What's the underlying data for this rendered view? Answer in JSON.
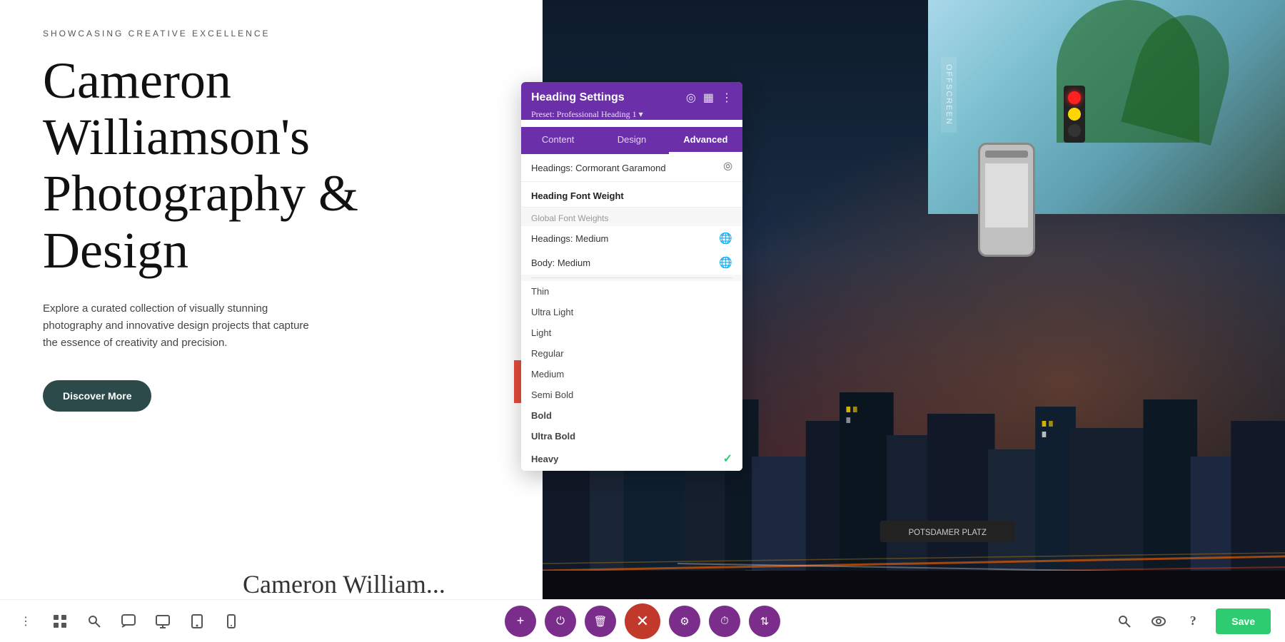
{
  "page": {
    "subtitle": "SHOWCASING CREATIVE EXCELLENCE",
    "main_heading": "Cameron Williamson's Photography & Design",
    "description": "Explore a curated collection of visually stunning photography and innovative design projects that capture the essence of creativity and precision.",
    "cta_button": "Discover More",
    "offscreen_label": "Offscreen",
    "bottom_partial_text": "Cameron William..."
  },
  "panel": {
    "title": "Heading Settings",
    "preset_label": "Preset: Professional Heading 1 ▾",
    "tabs": [
      {
        "id": "content",
        "label": "Content",
        "active": false
      },
      {
        "id": "design",
        "label": "Design",
        "active": false
      },
      {
        "id": "advanced",
        "label": "Advanced",
        "active": true
      }
    ],
    "font_selector": {
      "label": "Headings: Cormorant Garamond",
      "icon": "chevron-icon"
    },
    "font_weight_section": {
      "title": "Heading Font Weight",
      "global_group_label": "Global Font Weights",
      "global_items": [
        {
          "label": "Headings: Medium",
          "icon": "globe"
        },
        {
          "label": "Body: Medium",
          "icon": "globe"
        }
      ],
      "font_weights": [
        {
          "label": "Thin",
          "value": "100",
          "selected": false
        },
        {
          "label": "Ultra Light",
          "value": "200",
          "selected": false
        },
        {
          "label": "Light",
          "value": "300",
          "selected": false
        },
        {
          "label": "Regular",
          "value": "400",
          "selected": false
        },
        {
          "label": "Medium",
          "value": "500",
          "selected": false
        },
        {
          "label": "Semi Bold",
          "value": "600",
          "selected": false
        },
        {
          "label": "Bold",
          "value": "700",
          "selected": false,
          "bold": true
        },
        {
          "label": "Ultra Bold",
          "value": "800",
          "selected": false,
          "bold": true
        },
        {
          "label": "Heavy",
          "value": "900",
          "selected": true,
          "bold": true
        }
      ]
    },
    "icons": {
      "target": "◎",
      "grid": "▦",
      "more": "⋮"
    }
  },
  "toolbar": {
    "left_icons": [
      "⋮",
      "⊞",
      "⊙",
      "💬",
      "▭",
      "📱"
    ],
    "center_buttons": [
      {
        "id": "add",
        "icon": "+",
        "color": "purple"
      },
      {
        "id": "power",
        "icon": "⏻",
        "color": "purple"
      },
      {
        "id": "trash",
        "icon": "🗑",
        "color": "purple"
      },
      {
        "id": "close",
        "icon": "✕",
        "color": "close"
      },
      {
        "id": "settings",
        "icon": "⚙",
        "color": "purple"
      },
      {
        "id": "history",
        "icon": "⏱",
        "color": "purple"
      },
      {
        "id": "adjust",
        "icon": "⇅",
        "color": "purple"
      }
    ],
    "right_icons": [
      "🔍",
      "👁",
      "?"
    ],
    "save_label": "Save"
  }
}
